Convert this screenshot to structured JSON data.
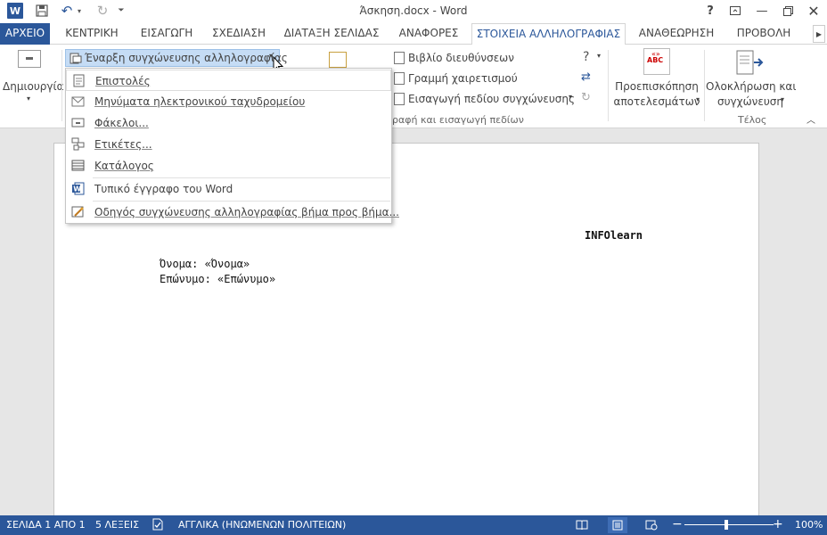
{
  "window": {
    "title": "Άσκηση.docx - Word",
    "app_icon_text": "W"
  },
  "tabs": [
    {
      "label": "ΑΡΧΕΙΟ"
    },
    {
      "label": "ΚΕΝΤΡΙΚΗ"
    },
    {
      "label": "ΕΙΣΑΓΩΓΗ"
    },
    {
      "label": "ΣΧΕΔΙΑΣΗ"
    },
    {
      "label": "ΔΙΑΤΑΞΗ ΣΕΛΙΔΑΣ"
    },
    {
      "label": "ΑΝΑΦΟΡΕΣ"
    },
    {
      "label": "ΣΤΟΙΧΕΙΑ ΑΛΛΗΛΟΓΡΑΦΙΑΣ"
    },
    {
      "label": "ΑΝΑΘΕΩΡΗΣΗ"
    },
    {
      "label": "ΠΡΟΒΟΛΗ"
    }
  ],
  "ribbon": {
    "create_label": "Δημιουργία",
    "start_mail_merge_label": "Έναρξη συγχώνευσης αλληλογραφίας",
    "address_block_label": "Βιβλίο διευθύνσεων",
    "greeting_line_label": "Γραμμή χαιρετισμού",
    "insert_merge_field_label": "Εισαγωγή πεδίου συγχώνευσης",
    "write_insert_group_label": "ραφή και εισαγωγή πεδίων",
    "preview_label_1": "Προεπισκόπηση",
    "preview_label_2": "αποτελεσμάτων",
    "finish_label_1": "Ολοκλήρωση και",
    "finish_label_2": "συγχώνευση",
    "finish_group_label": "Τέλος",
    "abc_text": "ABC"
  },
  "menu": {
    "items": [
      {
        "label": "Επιστολές",
        "icon": "letters-icon"
      },
      {
        "label": "Μηνύματα ηλεκτρονικού ταχυδρομείου",
        "icon": "email-icon"
      },
      {
        "label": "Φάκελοι...",
        "icon": "envelope-icon"
      },
      {
        "label": "Ετικέτες...",
        "icon": "labels-icon"
      },
      {
        "label": "Κατάλογος",
        "icon": "directory-icon"
      },
      {
        "label": "Τυπικό έγγραφο του Word",
        "icon": "word-doc-icon"
      },
      {
        "label": "Οδηγός συγχώνευσης αλληλογραφίας βήμα προς βήμα...",
        "icon": "wizard-icon"
      }
    ]
  },
  "document": {
    "header_text": "INFOlearn",
    "line1": "Όνομα: «Όνομα»",
    "line2": "Επώνυμο: «Επώνυμο»"
  },
  "status": {
    "page": "ΣΕΛΙΔΑ 1 ΑΠΟ 1",
    "words": "5 ΛΕΞΕΙΣ",
    "language": "ΑΓΓΛΙΚΑ (ΗΝΩΜΕΝΩΝ ΠΟΛΙΤΕΙΩΝ)",
    "zoom": "100%"
  },
  "colors": {
    "accent": "#2b579a",
    "highlight": "#c5dcf5"
  }
}
